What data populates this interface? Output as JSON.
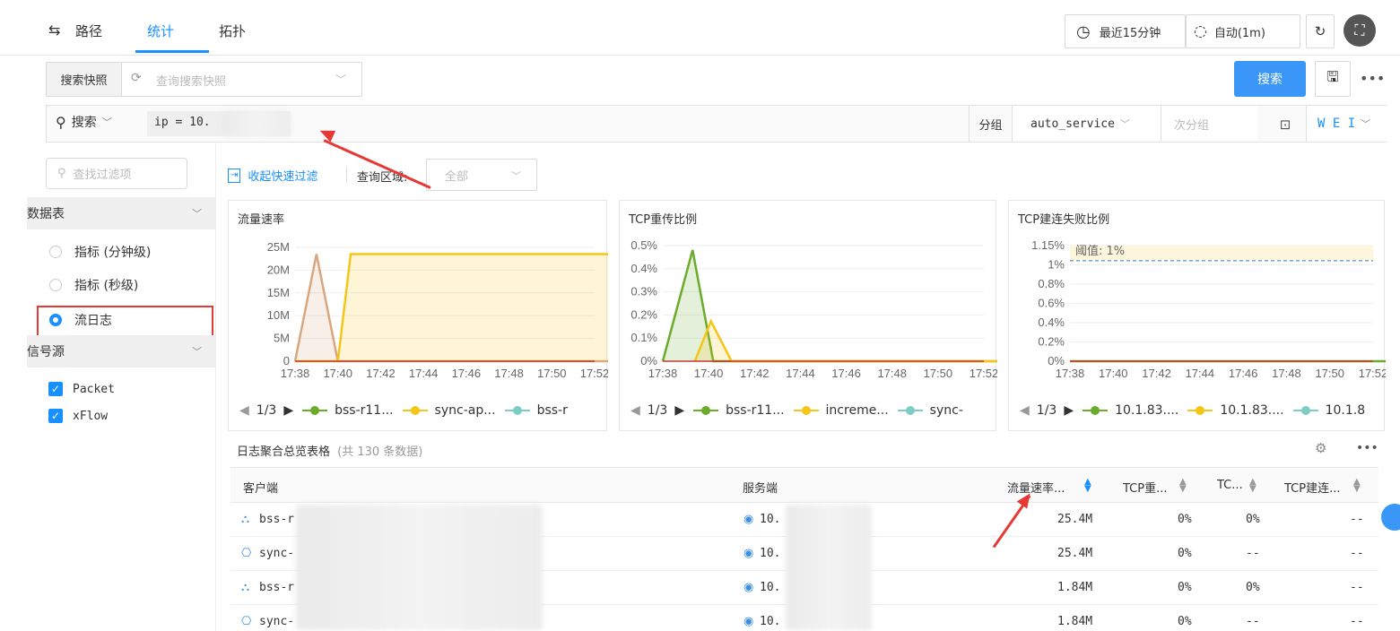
{
  "topnav": {
    "tabs": [
      {
        "label": "路径"
      },
      {
        "label": "统计"
      },
      {
        "label": "拓扑"
      }
    ],
    "time_range": "最近15分钟",
    "auto_refresh": "自动(1m)"
  },
  "snapshot": {
    "label": "搜索快照",
    "placeholder": "查询搜索快照",
    "search_button": "搜索"
  },
  "query": {
    "search_mode": "搜索",
    "value": "ip = 10.",
    "group_label": "分组",
    "group_value": "auto_service",
    "subgroup_placeholder": "次分组",
    "trailing": "W E I"
  },
  "sidebar": {
    "filter_placeholder": "查找过滤项",
    "section_datatable": "数据表",
    "datatable_options": [
      {
        "label": "指标 (分钟级)",
        "selected": false
      },
      {
        "label": "指标 (秒级)",
        "selected": false
      },
      {
        "label": "流日志",
        "selected": true
      }
    ],
    "section_source": "信号源",
    "sources": [
      {
        "label": "Packet",
        "checked": true
      },
      {
        "label": "xFlow",
        "checked": true
      }
    ]
  },
  "quickfilter": {
    "collapse_label": "收起快速过滤",
    "region_label": "查询区域:",
    "region_value": "全部"
  },
  "charts": {
    "panels": [
      {
        "title": "流量速率",
        "page": "1/3",
        "legend": [
          "bss-r11...",
          "sync-ap...",
          "bss-r"
        ]
      },
      {
        "title": "TCP重传比例",
        "page": "1/3",
        "legend": [
          "bss-r11...",
          "increme...",
          "sync-"
        ]
      },
      {
        "title": "TCP建连失败比例",
        "page": "1/3",
        "legend": [
          "10.1.83....",
          "10.1.83....",
          "10.1.8"
        ],
        "threshold_label": "阈值: 1%"
      }
    ]
  },
  "chart_data": [
    {
      "type": "area",
      "title": "流量速率",
      "x": [
        "17:38",
        "17:40",
        "17:42",
        "17:44",
        "17:46",
        "17:48",
        "17:50",
        "17:52"
      ],
      "y_ticks": [
        "25M",
        "20M",
        "15M",
        "10M",
        "5M",
        "0"
      ],
      "ylim": [
        0,
        27
      ],
      "series": [
        {
          "name": "bss-r11...",
          "color": "#d9a77f",
          "points": [
            [
              0,
              0
            ],
            [
              0.5,
              25.4
            ],
            [
              1,
              0
            ],
            [
              8,
              0
            ]
          ]
        },
        {
          "name": "sync-ap...",
          "color": "#f5c518",
          "points": [
            [
              0,
              0
            ],
            [
              1,
              0
            ],
            [
              1.3,
              25.4
            ],
            [
              8,
              25.4
            ]
          ]
        }
      ]
    },
    {
      "type": "area",
      "title": "TCP重传比例",
      "x": [
        "17:38",
        "17:40",
        "17:42",
        "17:44",
        "17:46",
        "17:48",
        "17:50",
        "17:52"
      ],
      "y_ticks": [
        "0.5%",
        "0.4%",
        "0.3%",
        "0.2%",
        "0.1%",
        "0%"
      ],
      "ylim": [
        0,
        0.52
      ],
      "series": [
        {
          "name": "bss-r11...",
          "color": "#6aab2b",
          "points": [
            [
              0,
              0
            ],
            [
              0.65,
              0.5
            ],
            [
              1.1,
              0
            ],
            [
              8,
              0
            ]
          ]
        },
        {
          "name": "increme...",
          "color": "#f5c518",
          "points": [
            [
              0.7,
              0
            ],
            [
              1.05,
              0.18
            ],
            [
              1.5,
              0
            ],
            [
              8,
              0
            ]
          ]
        }
      ]
    },
    {
      "type": "line",
      "title": "TCP建连失败比例",
      "x": [
        "17:38",
        "17:40",
        "17:42",
        "17:44",
        "17:46",
        "17:48",
        "17:50",
        "17:52"
      ],
      "y_ticks": [
        "1.15%",
        "1%",
        "0.8%",
        "0.6%",
        "0.4%",
        "0.2%",
        "0%"
      ],
      "ylim": [
        0,
        1.15
      ],
      "threshold": 1,
      "series": [
        {
          "name": "10.1.83....",
          "color": "#6aab2b",
          "points": [
            [
              0,
              0
            ],
            [
              8,
              0
            ]
          ]
        }
      ]
    }
  ],
  "table": {
    "title": "日志聚合总览表格",
    "count_text": "(共 130 条数据)",
    "headers": [
      "客户端",
      "服务端",
      "流量速率...",
      "TCP重...",
      "TC...",
      "TCP建连..."
    ],
    "rows": [
      {
        "client": "bss-r",
        "server": "10.",
        "rate": "25.4M",
        "c4": "0%",
        "c5": "0%",
        "c6": "--"
      },
      {
        "client": "sync-",
        "server": "10.",
        "rate": "25.4M",
        "c4": "0%",
        "c5": "--",
        "c6": "--"
      },
      {
        "client": "bss-r",
        "server": "10.",
        "rate": "1.84M",
        "c4": "0%",
        "c5": "0%",
        "c6": "--"
      },
      {
        "client": "sync-",
        "server": "10.",
        "rate": "1.84M",
        "c4": "0%",
        "c5": "--",
        "c6": "--"
      }
    ]
  },
  "colors": {
    "accent": "#1890ff",
    "primary_button": "#3b97f7",
    "highlight_box": "#e53935"
  }
}
